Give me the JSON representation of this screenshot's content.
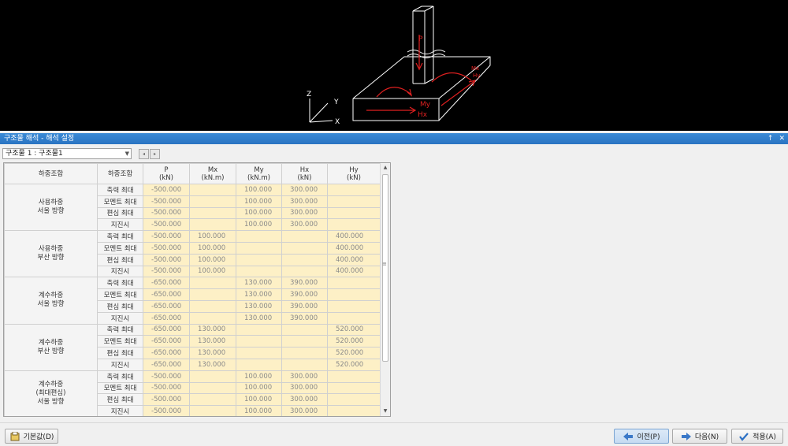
{
  "diagram": {
    "force_labels": [
      "P",
      "My",
      "Hx",
      "Mx",
      "Hy"
    ],
    "axis_labels": [
      "Z",
      "Y",
      "X"
    ]
  },
  "panel": {
    "title": "구조물 해석 - 해석 설정",
    "pin_glyph": "↑",
    "close_glyph": "✕",
    "structure_select": "구조물 1 : 구조물1",
    "nav_prev": "◂",
    "nav_next": "▸"
  },
  "table": {
    "headers": {
      "group": "하중조합",
      "combo": "하중조합",
      "p": [
        "P",
        "(kN)"
      ],
      "mx": [
        "Mx",
        "(kN.m)"
      ],
      "my": [
        "My",
        "(kN.m)"
      ],
      "hx": [
        "Hx",
        "(kN)"
      ],
      "hy": [
        "Hy",
        "(kN)"
      ]
    },
    "groups": [
      {
        "name": [
          "사용하중",
          "서울 방향"
        ],
        "rows": [
          [
            "축력 최대",
            "-500.000",
            "",
            "100.000",
            "300.000",
            ""
          ],
          [
            "모멘트 최대",
            "-500.000",
            "",
            "100.000",
            "300.000",
            ""
          ],
          [
            "편심 최대",
            "-500.000",
            "",
            "100.000",
            "300.000",
            ""
          ],
          [
            "지진시",
            "-500.000",
            "",
            "100.000",
            "300.000",
            ""
          ]
        ]
      },
      {
        "name": [
          "사용하중",
          "부산 방향"
        ],
        "rows": [
          [
            "축력 최대",
            "-500.000",
            "100.000",
            "",
            "",
            "400.000"
          ],
          [
            "모멘트 최대",
            "-500.000",
            "100.000",
            "",
            "",
            "400.000"
          ],
          [
            "편심 최대",
            "-500.000",
            "100.000",
            "",
            "",
            "400.000"
          ],
          [
            "지진시",
            "-500.000",
            "100.000",
            "",
            "",
            "400.000"
          ]
        ]
      },
      {
        "name": [
          "계수하중",
          "서울 방향"
        ],
        "rows": [
          [
            "축력 최대",
            "-650.000",
            "",
            "130.000",
            "390.000",
            ""
          ],
          [
            "모멘트 최대",
            "-650.000",
            "",
            "130.000",
            "390.000",
            ""
          ],
          [
            "편심 최대",
            "-650.000",
            "",
            "130.000",
            "390.000",
            ""
          ],
          [
            "지진시",
            "-650.000",
            "",
            "130.000",
            "390.000",
            ""
          ]
        ]
      },
      {
        "name": [
          "계수하중",
          "부산 방향"
        ],
        "rows": [
          [
            "축력 최대",
            "-650.000",
            "130.000",
            "",
            "",
            "520.000"
          ],
          [
            "모멘트 최대",
            "-650.000",
            "130.000",
            "",
            "",
            "520.000"
          ],
          [
            "편심 최대",
            "-650.000",
            "130.000",
            "",
            "",
            "520.000"
          ],
          [
            "지진시",
            "-650.000",
            "130.000",
            "",
            "",
            "520.000"
          ]
        ]
      },
      {
        "name": [
          "계수하중",
          "(최대편심)",
          "서울 방향"
        ],
        "rows": [
          [
            "축력 최대",
            "-500.000",
            "",
            "100.000",
            "300.000",
            ""
          ],
          [
            "모멘트 최대",
            "-500.000",
            "",
            "100.000",
            "300.000",
            ""
          ],
          [
            "편심 최대",
            "-500.000",
            "",
            "100.000",
            "300.000",
            ""
          ],
          [
            "지진시",
            "-500.000",
            "",
            "100.000",
            "300.000",
            ""
          ]
        ]
      }
    ]
  },
  "buttons": {
    "default": "기본값(D)",
    "prev": "이전(P)",
    "next": "다음(N)",
    "apply": "적용(A)"
  },
  "colors": {
    "value_cell": "#fdf0c6",
    "title_bar": "#2a74c2",
    "force_arrow": "#e02020"
  }
}
